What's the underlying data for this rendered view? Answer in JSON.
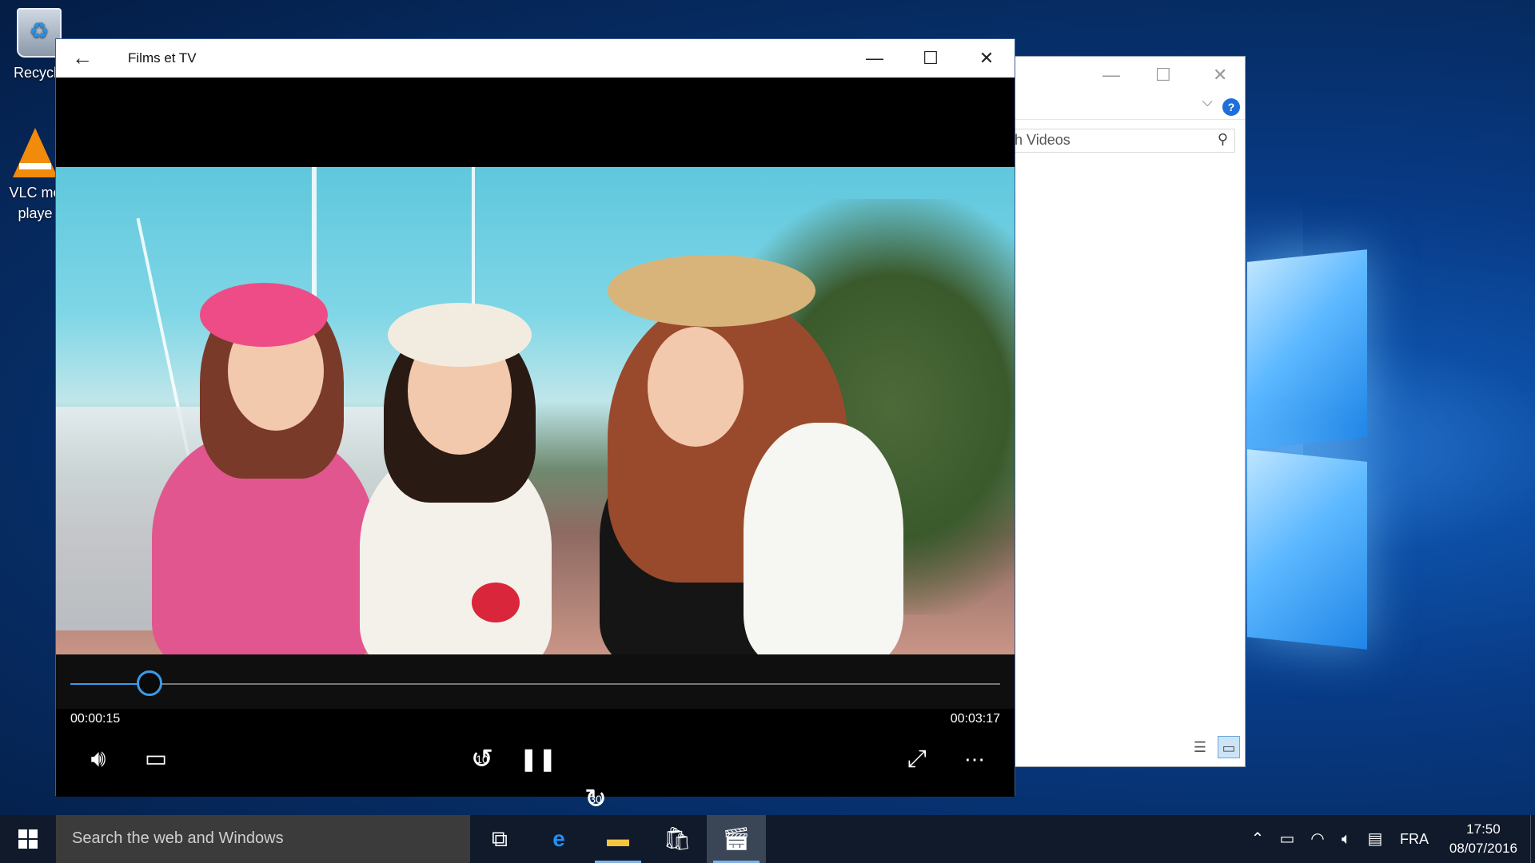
{
  "desktop": {
    "icons": [
      {
        "label": "Recycle"
      },
      {
        "label": "VLC me playe"
      }
    ]
  },
  "explorer": {
    "search_placeholder": "arch Videos",
    "minimize": "—",
    "maximize": "☐",
    "close": "✕",
    "help": "?"
  },
  "films": {
    "title": "Films et TV",
    "current_time": "00:00:15",
    "total_time": "00:03:17",
    "progress": 0.085,
    "skip_back_seconds": "10",
    "skip_forward_seconds": "30"
  },
  "taskbar": {
    "search_placeholder": "Search the web and Windows",
    "language": "FRA",
    "time": "17:50",
    "date": "08/07/2016"
  },
  "colors": {
    "accent": "#3b9be9",
    "taskbar": "#101a2a"
  }
}
